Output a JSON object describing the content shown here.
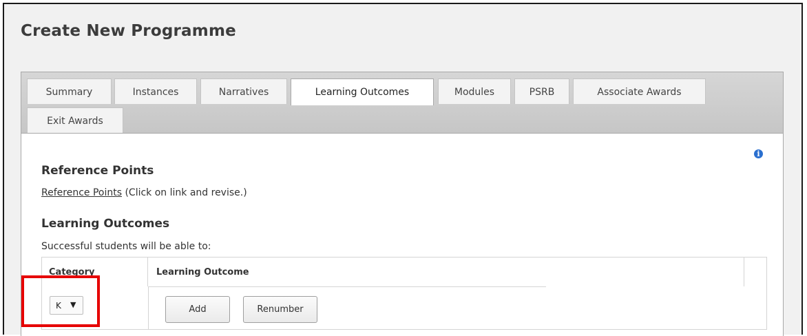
{
  "page": {
    "title": "Create New Programme"
  },
  "tabs": [
    {
      "label": "Summary",
      "active": false
    },
    {
      "label": "Instances",
      "active": false
    },
    {
      "label": "Narratives",
      "active": false
    },
    {
      "label": "Learning Outcomes",
      "active": true
    },
    {
      "label": "Modules",
      "active": false
    },
    {
      "label": "PSRB",
      "active": false
    },
    {
      "label": "Associate Awards",
      "active": false
    },
    {
      "label": "Exit Awards",
      "active": false
    }
  ],
  "reference_points": {
    "heading": "Reference Points",
    "link_text": "Reference Points",
    "suffix_text": " (Click on link and revise.)"
  },
  "learning_outcomes": {
    "heading": "Learning Outcomes",
    "intro": "Successful students will be able to:",
    "table": {
      "columns": [
        "Category",
        "Learning Outcome"
      ],
      "category_select": {
        "selected": "K"
      },
      "buttons": {
        "add": "Add",
        "renumber": "Renumber"
      }
    }
  },
  "icons": {
    "info": "info-icon",
    "caret": "caret-down-icon"
  },
  "colors": {
    "highlight": "#e60000",
    "info_icon": "#2a6fcf",
    "tabbar": "#cfcfcf"
  }
}
